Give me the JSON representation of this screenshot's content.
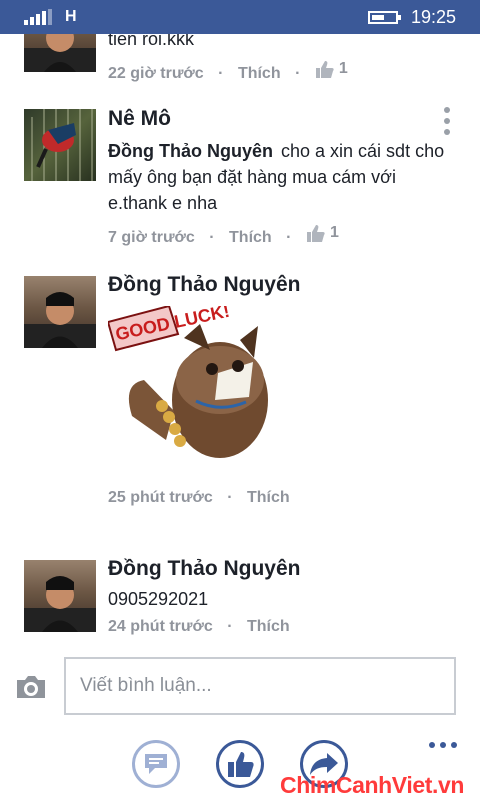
{
  "status_bar": {
    "network": "H",
    "time": "19:25",
    "battery_level": 0.55
  },
  "comments": [
    {
      "author": "",
      "text": "tiền rồi.kkk",
      "time": "22 giờ trước",
      "like_label": "Thích",
      "like_count": "1",
      "avatar_icon": "person-icon"
    },
    {
      "author": "Nê Mô",
      "mention": "Đồng Thảo Nguyên",
      "text": "cho a xin cái sdt cho mấy ông bạn đặt hàng mua cám với e.thank e nha",
      "time": "7 giờ trước",
      "like_label": "Thích",
      "like_count": "1",
      "avatar_icon": "bird-icon"
    },
    {
      "author": "Đồng Thảo Nguyên",
      "sticker": "GOOD LUCK!",
      "time": "25 phút trước",
      "like_label": "Thích",
      "avatar_icon": "person-icon"
    },
    {
      "author": "Đồng Thảo Nguyên",
      "text": "0905292021",
      "time": "24 phút trước",
      "like_label": "Thích",
      "avatar_icon": "person-icon"
    }
  ],
  "compose": {
    "placeholder": "Viết bình luận...",
    "camera_icon": "camera-icon",
    "actions": [
      "comment-icon",
      "thumbs-up-icon",
      "share-icon"
    ],
    "more_icon": "more-icon"
  },
  "watermark": "ChimCanhViet.vn",
  "colors": {
    "brand": "#3b5998",
    "meta": "#90949c",
    "watermark": "#ff3b3b"
  }
}
